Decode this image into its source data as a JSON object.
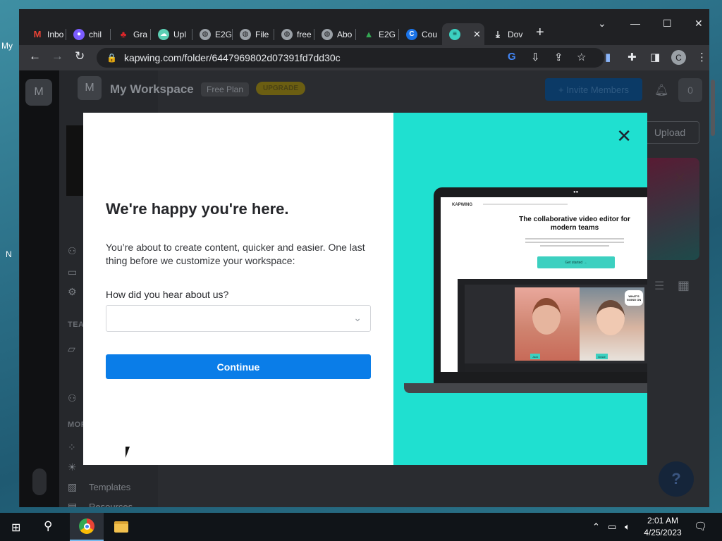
{
  "desktop": {
    "icon_labels": [
      "My",
      "N"
    ]
  },
  "browser": {
    "tabs": [
      {
        "label": "Inbo",
        "icon": "gmail-icon",
        "color": "#ea4335"
      },
      {
        "label": "chil",
        "icon": "reddit-icon",
        "color": "#7b5cff"
      },
      {
        "label": "Gra",
        "icon": "grammarly-icon",
        "color": "#e0262a"
      },
      {
        "label": "Upl",
        "icon": "cloud-icon",
        "color": "#5ccfb4"
      },
      {
        "label": "E2G",
        "icon": "globe-icon",
        "color": "#9aa0a6"
      },
      {
        "label": "File",
        "icon": "globe-icon",
        "color": "#9aa0a6"
      },
      {
        "label": "free",
        "icon": "globe-icon",
        "color": "#9aa0a6"
      },
      {
        "label": "Abo",
        "icon": "globe-icon",
        "color": "#9aa0a6"
      },
      {
        "label": "E2G",
        "icon": "drive-icon",
        "color": "#34a853"
      },
      {
        "label": "Cou",
        "icon": "coursera-icon",
        "color": "#1a73e8"
      },
      {
        "label": "",
        "icon": "kapwing-icon",
        "color": "#3cd0c0",
        "active": true
      },
      {
        "label": "Dov",
        "icon": "download-icon",
        "color": "#e8eaed"
      }
    ],
    "url": "kapwing.com/folder/6447969802d07391fd7dd30c",
    "profile_initial": "C"
  },
  "app": {
    "workspace_initial": "M",
    "workspace_title": "My Workspace",
    "plan": "Free Plan",
    "upgrade": "UPGRADE",
    "invite_label": "+ Invite Members",
    "user_initial": "0",
    "upload_label": "Upload",
    "sidebar": {
      "team_heading": "TEAI",
      "more_heading": "MOR",
      "items": [
        "Templates",
        "Resources"
      ]
    },
    "help": "?"
  },
  "modal": {
    "title": "We're happy you're here.",
    "body": "You’re about to create content, quicker and easier. One last thing before we customize your workspace:",
    "question": "How did you hear about us?",
    "select_value": "",
    "continue_label": "Continue",
    "illustration": {
      "logo": "KAPWING",
      "headline": "The collaborative video editor for modern teams",
      "cta": "Get started →",
      "bubble": "WHAT'S GOING ON",
      "tag_left": "Jack",
      "tag_right": "Grace"
    }
  },
  "taskbar": {
    "time": "2:01 AM",
    "date": "4/25/2023"
  }
}
